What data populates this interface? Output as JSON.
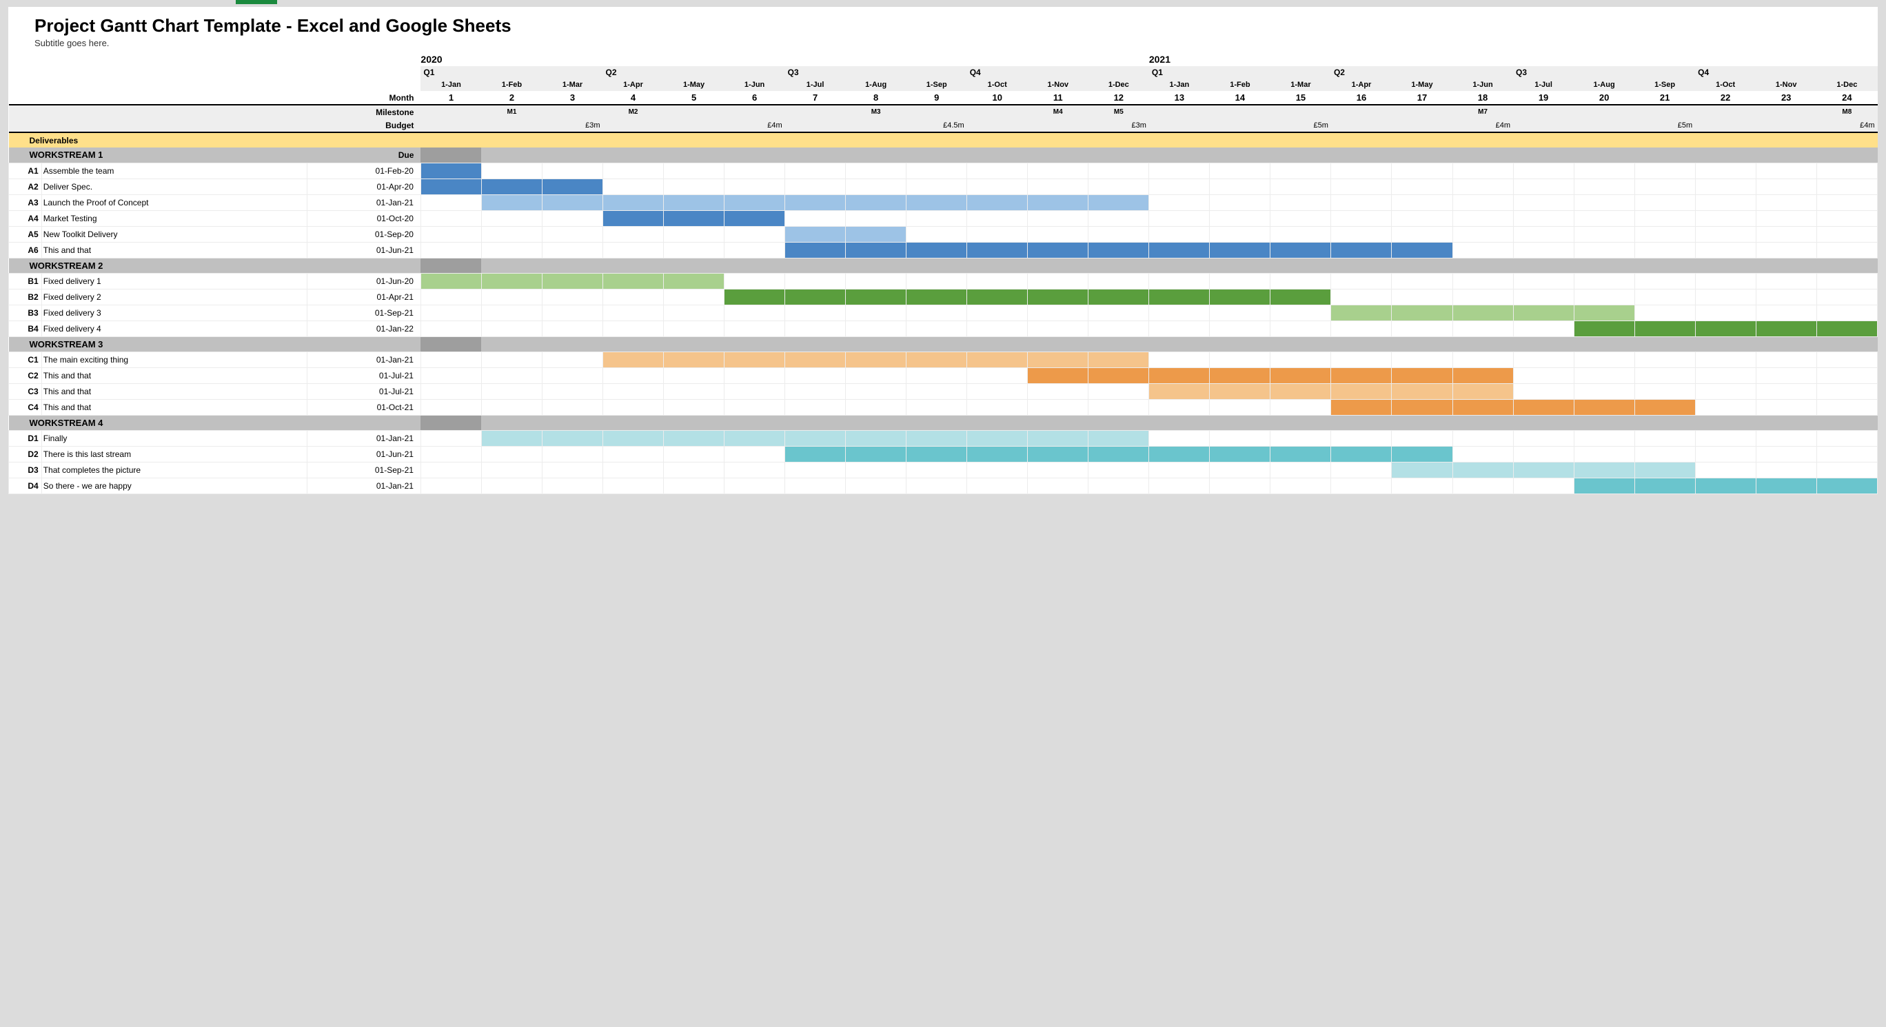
{
  "title": "Project Gantt Chart Template - Excel and Google Sheets",
  "subtitle": "Subtitle goes here.",
  "labels": {
    "month": "Month",
    "milestone": "Milestone",
    "budget": "Budget",
    "deliverables": "Deliverables",
    "due": "Due"
  },
  "timeline": {
    "years": [
      {
        "label": "2020",
        "start": 1
      },
      {
        "label": "2021",
        "start": 13
      }
    ],
    "quarters": [
      "Q1",
      "Q2",
      "Q3",
      "Q4",
      "Q1",
      "Q2",
      "Q3",
      "Q4"
    ],
    "months": [
      "1-Jan",
      "1-Feb",
      "1-Mar",
      "1-Apr",
      "1-May",
      "1-Jun",
      "1-Jul",
      "1-Aug",
      "1-Sep",
      "1-Oct",
      "1-Nov",
      "1-Dec",
      "1-Jan",
      "1-Feb",
      "1-Mar",
      "1-Apr",
      "1-May",
      "1-Jun",
      "1-Jul",
      "1-Aug",
      "1-Sep",
      "1-Oct",
      "1-Nov",
      "1-Dec"
    ],
    "month_numbers": [
      1,
      2,
      3,
      4,
      5,
      6,
      7,
      8,
      9,
      10,
      11,
      12,
      13,
      14,
      15,
      16,
      17,
      18,
      19,
      20,
      21,
      22,
      23,
      24
    ]
  },
  "milestones": {
    "2": "M1",
    "4": "M2",
    "8": "M3",
    "11": "M4",
    "12": "M5",
    "18": "M7",
    "24": "M8"
  },
  "budget": {
    "3": "£3m",
    "6": "£4m",
    "9": "£4.5m",
    "12": "£3m",
    "15": "£5m",
    "18": "£4m",
    "21": "£5m",
    "24": "£4m"
  },
  "workstreams": [
    {
      "name": "WORKSTREAM 1",
      "colors": {
        "light": "#9dc3e6",
        "dark": "#4a86c5"
      },
      "tasks": [
        {
          "id": "A1",
          "name": "Assemble the team",
          "due": "01-Feb-20",
          "start": 1,
          "end": 1,
          "shade": "dark"
        },
        {
          "id": "A2",
          "name": "Deliver Spec.",
          "due": "01-Apr-20",
          "start": 1,
          "end": 3,
          "shade": "dark"
        },
        {
          "id": "A3",
          "name": "Launch the Proof of Concept",
          "due": "01-Jan-21",
          "start": 2,
          "end": 12,
          "shade": "light"
        },
        {
          "id": "A4",
          "name": "Market Testing",
          "due": "01-Oct-20",
          "start": 4,
          "end": 6,
          "shade": "dark"
        },
        {
          "id": "A5",
          "name": "New Toolkit Delivery",
          "due": "01-Sep-20",
          "start": 7,
          "end": 8,
          "shade": "light"
        },
        {
          "id": "A6",
          "name": "This and that",
          "due": "01-Jun-21",
          "start": 7,
          "end": 17,
          "shade": "dark"
        }
      ]
    },
    {
      "name": "WORKSTREAM 2",
      "colors": {
        "light": "#a8d08d",
        "dark": "#5a9e3d"
      },
      "tasks": [
        {
          "id": "B1",
          "name": "Fixed delivery 1",
          "due": "01-Jun-20",
          "start": 1,
          "end": 5,
          "shade": "light"
        },
        {
          "id": "B2",
          "name": "Fixed delivery 2",
          "due": "01-Apr-21",
          "start": 6,
          "end": 15,
          "shade": "dark"
        },
        {
          "id": "B3",
          "name": "Fixed delivery 3",
          "due": "01-Sep-21",
          "start": 16,
          "end": 20,
          "shade": "light"
        },
        {
          "id": "B4",
          "name": "Fixed delivery 4",
          "due": "01-Jan-22",
          "start": 20,
          "end": 24,
          "shade": "dark"
        }
      ]
    },
    {
      "name": "WORKSTREAM 3",
      "colors": {
        "light": "#f5c48b",
        "dark": "#ed9a4a"
      },
      "tasks": [
        {
          "id": "C1",
          "name": "The main exciting thing",
          "due": "01-Jan-21",
          "start": 4,
          "end": 12,
          "shade": "light"
        },
        {
          "id": "C2",
          "name": "This and that",
          "due": "01-Jul-21",
          "start": 11,
          "end": 18,
          "shade": "dark"
        },
        {
          "id": "C3",
          "name": "This and that",
          "due": "01-Jul-21",
          "start": 13,
          "end": 18,
          "shade": "light"
        },
        {
          "id": "C4",
          "name": "This and that",
          "due": "01-Oct-21",
          "start": 16,
          "end": 21,
          "shade": "dark"
        }
      ]
    },
    {
      "name": "WORKSTREAM 4",
      "colors": {
        "light": "#b3e0e5",
        "dark": "#6ac5cd"
      },
      "tasks": [
        {
          "id": "D1",
          "name": "Finally",
          "due": "01-Jan-21",
          "start": 2,
          "end": 12,
          "shade": "light"
        },
        {
          "id": "D2",
          "name": "There is this last stream",
          "due": "01-Jun-21",
          "start": 7,
          "end": 17,
          "shade": "dark"
        },
        {
          "id": "D3",
          "name": "That completes the picture",
          "due": "01-Sep-21",
          "start": 17,
          "end": 21,
          "shade": "light"
        },
        {
          "id": "D4",
          "name": "So there - we are happy",
          "due": "01-Jan-21",
          "start": 20,
          "end": 24,
          "shade": "dark"
        }
      ]
    }
  ],
  "chart_data": {
    "type": "bar",
    "title": "Project Gantt Chart Template - Excel and Google Sheets",
    "xlabel": "Month",
    "ylabel": "",
    "x": [
      1,
      2,
      3,
      4,
      5,
      6,
      7,
      8,
      9,
      10,
      11,
      12,
      13,
      14,
      15,
      16,
      17,
      18,
      19,
      20,
      21,
      22,
      23,
      24
    ],
    "series": [
      {
        "name": "A1 Assemble the team",
        "start": 1,
        "end": 1
      },
      {
        "name": "A2 Deliver Spec.",
        "start": 1,
        "end": 3
      },
      {
        "name": "A3 Launch the Proof of Concept",
        "start": 2,
        "end": 12
      },
      {
        "name": "A4 Market Testing",
        "start": 4,
        "end": 6
      },
      {
        "name": "A5 New Toolkit Delivery",
        "start": 7,
        "end": 8
      },
      {
        "name": "A6 This and that",
        "start": 7,
        "end": 17
      },
      {
        "name": "B1 Fixed delivery 1",
        "start": 1,
        "end": 5
      },
      {
        "name": "B2 Fixed delivery 2",
        "start": 6,
        "end": 15
      },
      {
        "name": "B3 Fixed delivery 3",
        "start": 16,
        "end": 20
      },
      {
        "name": "B4 Fixed delivery 4",
        "start": 20,
        "end": 24
      },
      {
        "name": "C1 The main exciting thing",
        "start": 4,
        "end": 12
      },
      {
        "name": "C2 This and that",
        "start": 11,
        "end": 18
      },
      {
        "name": "C3 This and that",
        "start": 13,
        "end": 18
      },
      {
        "name": "C4 This and that",
        "start": 16,
        "end": 21
      },
      {
        "name": "D1 Finally",
        "start": 2,
        "end": 12
      },
      {
        "name": "D2 There is this last stream",
        "start": 7,
        "end": 17
      },
      {
        "name": "D3 That completes the picture",
        "start": 17,
        "end": 21
      },
      {
        "name": "D4 So there - we are happy",
        "start": 20,
        "end": 24
      }
    ],
    "xlim": [
      1,
      24
    ]
  }
}
